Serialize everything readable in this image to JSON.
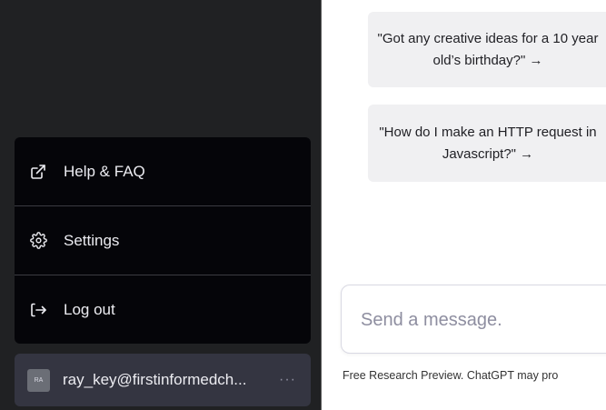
{
  "sidebar": {
    "menu": [
      {
        "label": "Help & FAQ",
        "icon": "external-link-icon"
      },
      {
        "label": "Settings",
        "icon": "gear-icon"
      },
      {
        "label": "Log out",
        "icon": "log-out-icon"
      }
    ],
    "user": {
      "avatar_initials": "RA",
      "email": "ray_key@firstinformedch...",
      "more": "···"
    }
  },
  "main": {
    "suggestions": [
      "\"Got any creative ideas for a 10 year old’s birthday?\" →",
      "\"How do I make an HTTP request in Javascript?\" →"
    ],
    "composer": {
      "placeholder": "Send a message."
    },
    "footer_note": "Free Research Preview. ChatGPT may pro"
  },
  "colors": {
    "sidebar_bg": "#202123",
    "menu_bg": "#050509",
    "user_row_bg": "#343541",
    "suggestion_bg": "#f0f0f2"
  }
}
